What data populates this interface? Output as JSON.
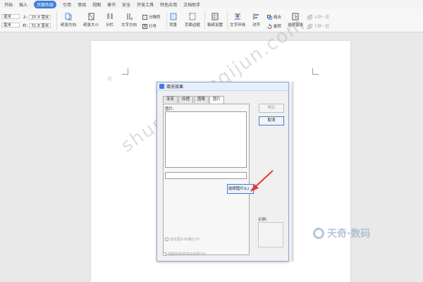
{
  "menu": [
    "开始",
    "插入",
    "页面布局",
    "引用",
    "审阅",
    "视图",
    "章节",
    "安全",
    "开发工具",
    "特色应用",
    "文档助手"
  ],
  "menu_active_index": 2,
  "ribbon": {
    "margin_top_label": "上:",
    "margin_top_value": "25.4 毫米",
    "margin_bottom_label": "下:",
    "margin_bottom_value": "25.4 毫米",
    "margin_left_label": "左:",
    "margin_left_value": "31.8 毫米",
    "margin_right_label": "右:",
    "margin_right_value": "31.8 毫米",
    "orientation": "纸张方向",
    "size": "纸张大小",
    "columns": "分栏",
    "text_direction": "文字方向",
    "breaks": "分隔符",
    "line_numbers": "行号",
    "background": "背景",
    "borders": "页面边框",
    "draft": "稿纸设置",
    "wrap": "文字环绕",
    "align": "对齐",
    "group": "组合",
    "rotate": "旋转",
    "selection_pane": "选择窗格",
    "bring_forward": "上移一层",
    "send_backward": "下移一层"
  },
  "dialog": {
    "title": "填充效果",
    "tabs": [
      "渐变",
      "纹理",
      "图案",
      "图片"
    ],
    "active_tab": 3,
    "picture_label": "图片:",
    "select_button": "选择图片(L)...",
    "ok": "确定",
    "cancel": "取消",
    "sample_label": "示例:",
    "lock_ratio": "锁定图片纵横比(P)",
    "rotate_with_shape": "随图形旋转填充效果(W)"
  },
  "watermark": "shuma.tianqijun.com",
  "logo": "天奇·数码",
  "colors": {
    "accent": "#3d7fd9",
    "arrow": "#e53935"
  }
}
